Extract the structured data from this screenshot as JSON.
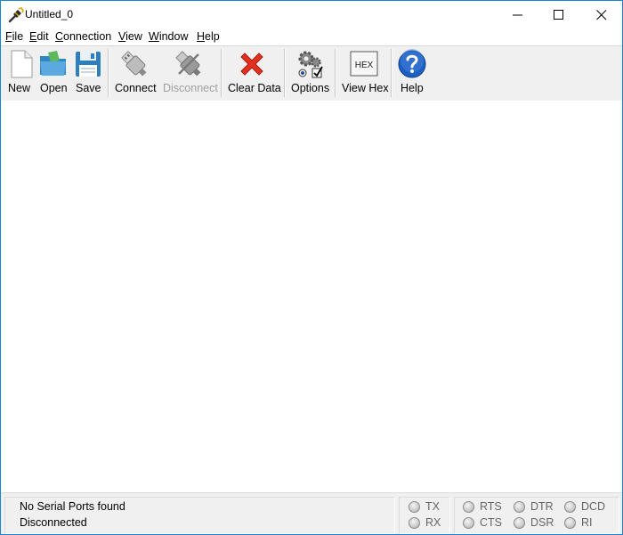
{
  "window": {
    "title": "Untitled_0"
  },
  "menu": {
    "file": "File",
    "edit": "Edit",
    "connection": "Connection",
    "view": "View",
    "window": "Window",
    "help": "Help"
  },
  "toolbar": {
    "new": "New",
    "open": "Open",
    "save": "Save",
    "connect": "Connect",
    "disconnect": "Disconnect",
    "clear_data": "Clear Data",
    "options": "Options",
    "view_hex": "View Hex",
    "help": "Help",
    "hex_icon_text": "HEX"
  },
  "status": {
    "line1": "No Serial Ports found",
    "line2": "Disconnected",
    "tx": "TX",
    "rx": "RX",
    "rts": "RTS",
    "cts": "CTS",
    "dtr": "DTR",
    "dsr": "DSR",
    "dcd": "DCD",
    "ri": "RI"
  },
  "colors": {
    "window_border": "#1883d7",
    "toolbar_bg": "#f0f0f0",
    "disabled_text": "#a0a0a0",
    "clear_red": "#e0301e",
    "help_blue": "#1e5fc4"
  }
}
